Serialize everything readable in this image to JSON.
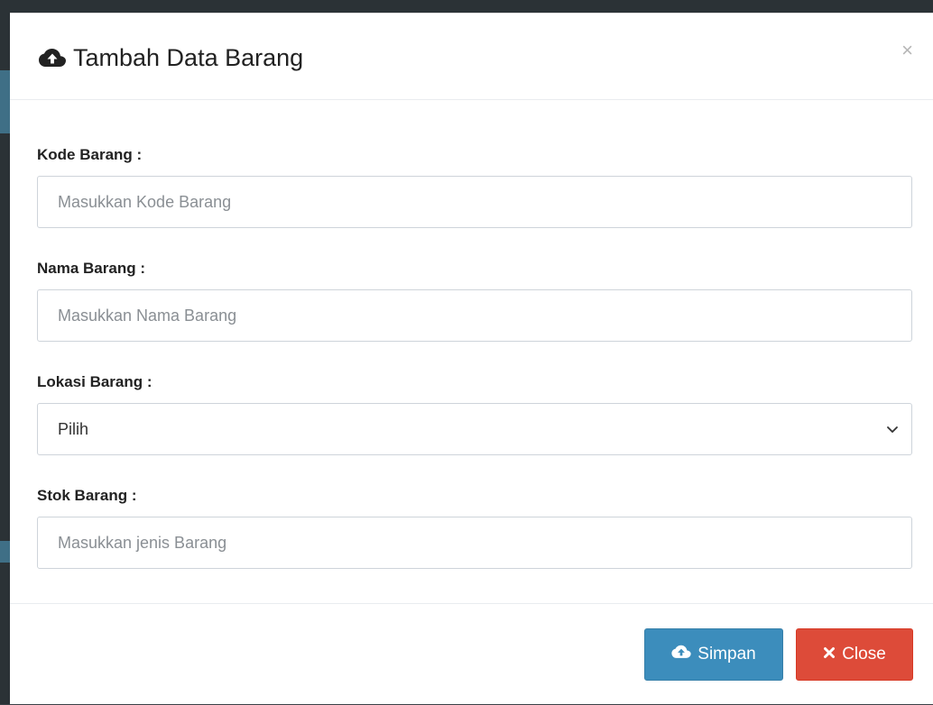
{
  "modal": {
    "title": "Tambah Data Barang",
    "close_symbol": "×"
  },
  "form": {
    "kode": {
      "label": "Kode Barang :",
      "placeholder": "Masukkan Kode Barang"
    },
    "nama": {
      "label": "Nama Barang :",
      "placeholder": "Masukkan Nama Barang"
    },
    "lokasi": {
      "label": "Lokasi Barang :",
      "selected": "Pilih"
    },
    "stok": {
      "label": "Stok Barang :",
      "placeholder": "Masukkan jenis Barang"
    }
  },
  "footer": {
    "simpan_label": "Simpan",
    "close_label": "Close"
  },
  "icons": {
    "title_icon": "cloud-upload-icon",
    "simpan_icon": "cloud-upload-icon",
    "close_icon": "times-icon",
    "select_icon": "chevron-down-icon"
  },
  "colors": {
    "primary": "#3c8dbc",
    "danger": "#dd4b39"
  }
}
